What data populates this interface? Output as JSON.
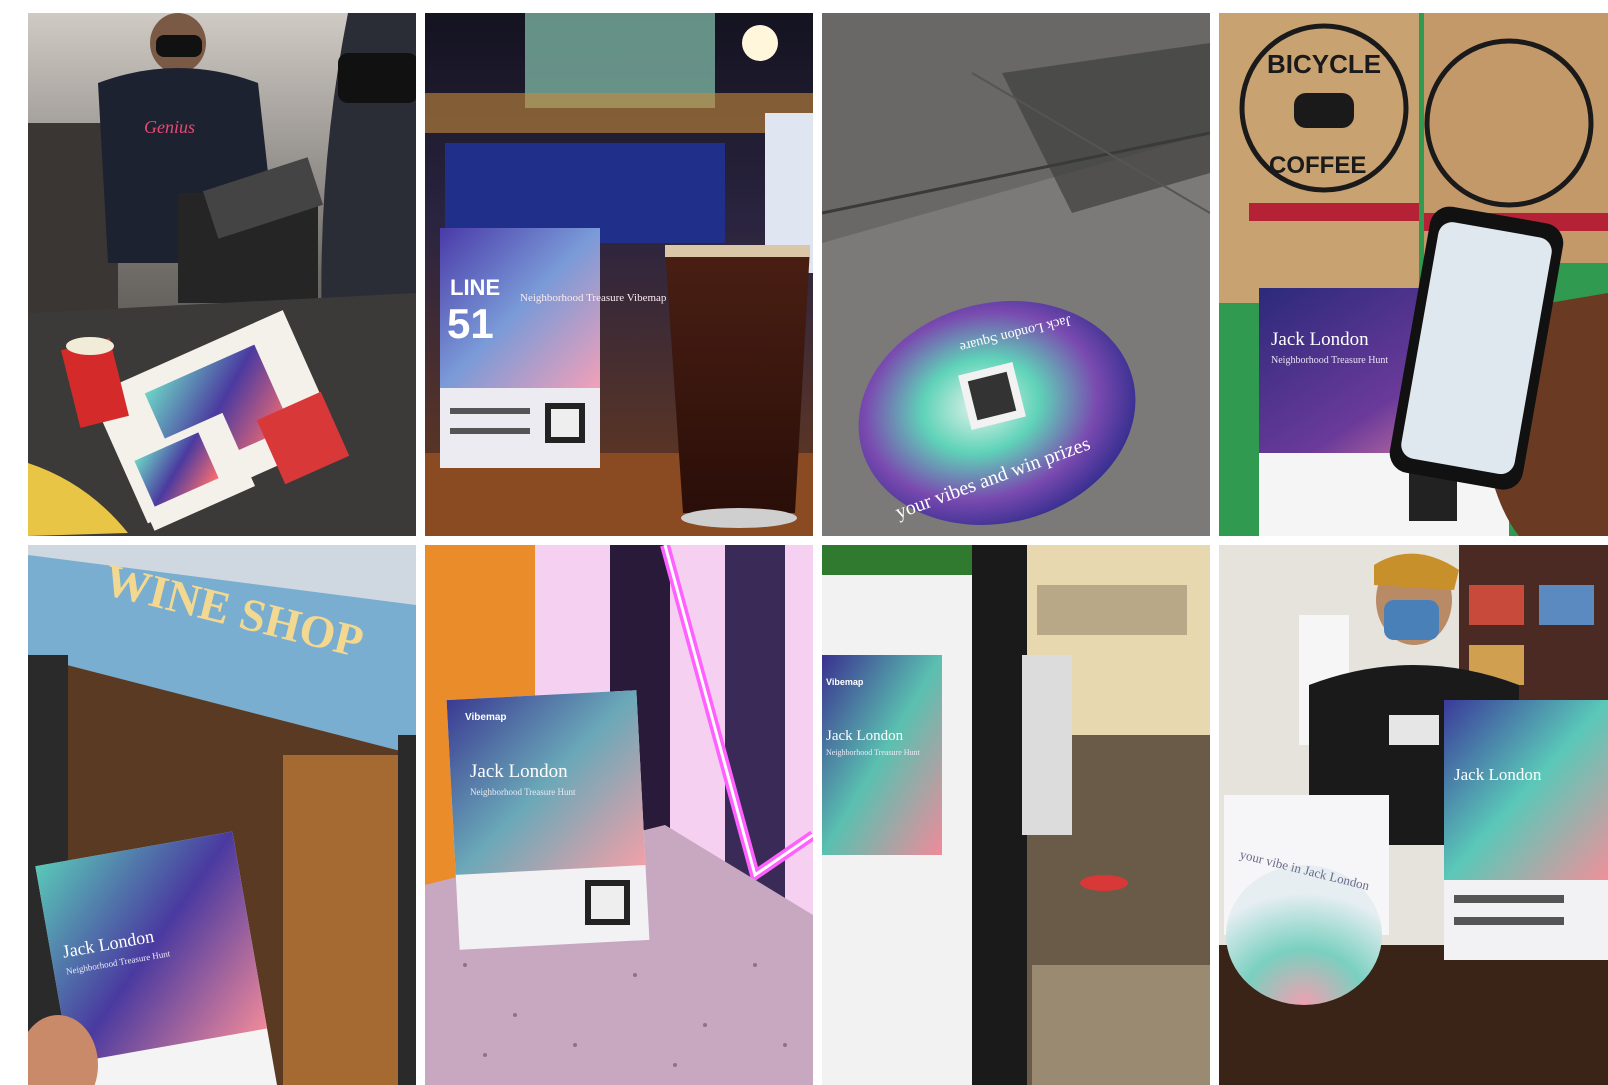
{
  "gallery": {
    "tiles": [
      {
        "scene": "cashier-counter",
        "shirt_text": "Genius",
        "flyer_colors": [
          "#3a2e8f",
          "#5fd1c1",
          "#ff7a6a"
        ]
      },
      {
        "scene": "bar-pint",
        "sign_line": "LINE",
        "sign_number": "51",
        "sign_heading": "Neighborhood Treasure Vibemap"
      },
      {
        "scene": "sidewalk-decal",
        "decal_text_bottom": "your vibes and win prizes",
        "decal_text_top": "Jack London Square"
      },
      {
        "scene": "coffee-bags",
        "bag_brand_top": "BICYCLE",
        "bag_brand_bottom": "COFFEE",
        "flyer_title": "Jack London",
        "flyer_subtitle": "Neighborhood Treasure Hunt"
      },
      {
        "scene": "wine-shop-front",
        "sign_text": "WINE SHOP",
        "flyer_title": "Jack London",
        "flyer_subtitle": "Neighborhood Treasure Hunt"
      },
      {
        "scene": "neon-table-tent",
        "flyer_title": "Jack London",
        "flyer_subtitle": "Neighborhood Treasure Hunt",
        "brand": "Vibemap"
      },
      {
        "scene": "window-poster",
        "flyer_title": "Jack London",
        "flyer_subtitle": "Neighborhood Treasure Hunt",
        "brand": "Vibemap"
      },
      {
        "scene": "barista-counter",
        "flyer_title": "Jack London",
        "card_text": "your vibe in Jack London"
      }
    ]
  }
}
